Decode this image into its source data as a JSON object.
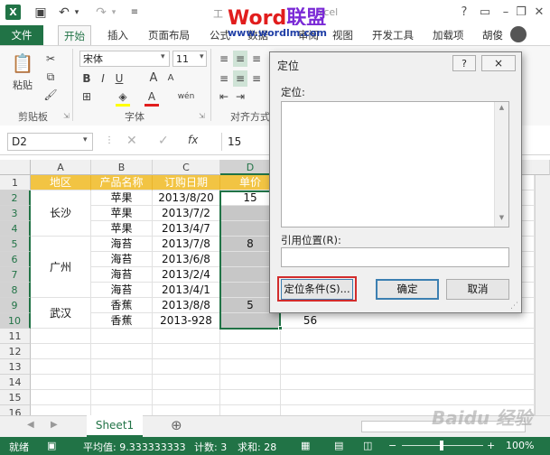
{
  "app": {
    "title_fragment": "工",
    "title_suffix": "xcel",
    "brand_word": "Word",
    "brand_cn": "联盟",
    "brand_url": "www.wordlm.com",
    "user": "胡俊",
    "help_label": "?"
  },
  "tabs": [
    "文件",
    "开始",
    "插入",
    "页面布局",
    "公式",
    "数据",
    "审阅",
    "视图",
    "开发工具",
    "加载项"
  ],
  "ribbon": {
    "paste_label": "粘贴",
    "clipboard_label": "剪贴板",
    "font_label": "字体",
    "align_label": "对齐方式",
    "font_name": "宋体",
    "font_size": "11",
    "bold": "B",
    "italic": "I",
    "underline": "U",
    "grow_font": "A",
    "shrink_font": "A",
    "font_color_glyph": "A",
    "phonetic_glyph": "wén"
  },
  "formula_bar": {
    "name_box": "D2",
    "fx": "fx",
    "value": "15"
  },
  "columns": [
    "A",
    "B",
    "C",
    "D"
  ],
  "rows": [
    "1",
    "2",
    "3",
    "4",
    "5",
    "6",
    "7",
    "8",
    "9",
    "10",
    "11",
    "12",
    "13",
    "14",
    "15",
    "16"
  ],
  "table": {
    "headers": [
      "地区",
      "产品名称",
      "订购日期",
      "单价"
    ],
    "regions": [
      "长沙",
      "广州",
      "武汉"
    ],
    "products": [
      "苹果",
      "苹果",
      "苹果",
      "海苔",
      "海苔",
      "海苔",
      "海苔",
      "香蕉",
      "香蕉"
    ],
    "dates": [
      "2013/8/20",
      "2013/7/2",
      "2013/4/7",
      "2013/7/8",
      "2013/6/8",
      "2013/2/4",
      "2013/4/1",
      "2013/8/8",
      "2013-928"
    ],
    "prices": [
      "15",
      "",
      "",
      "8",
      "",
      "",
      "",
      "5",
      ""
    ],
    "extra_e10": "56"
  },
  "sheet_tabs": {
    "active": "Sheet1",
    "add": "⊕"
  },
  "status": {
    "mode": "就绪",
    "average": "平均值: 9.333333333",
    "count": "计数: 3",
    "sum": "求和: 28",
    "zoom": "100%"
  },
  "dialog": {
    "title": "定位",
    "help": "?",
    "close": "×",
    "goto_label": "定位:",
    "ref_label": "引用位置(R):",
    "ref_value": "",
    "special_button": "定位条件(S)...",
    "ok_button": "确定",
    "cancel_button": "取消"
  },
  "watermark": "Baidu 经验",
  "colors": {
    "excel_green": "#217346",
    "header_fill": "#f2c443",
    "selection": "#c7c7c7",
    "highlight_border": "#d22c2c"
  }
}
